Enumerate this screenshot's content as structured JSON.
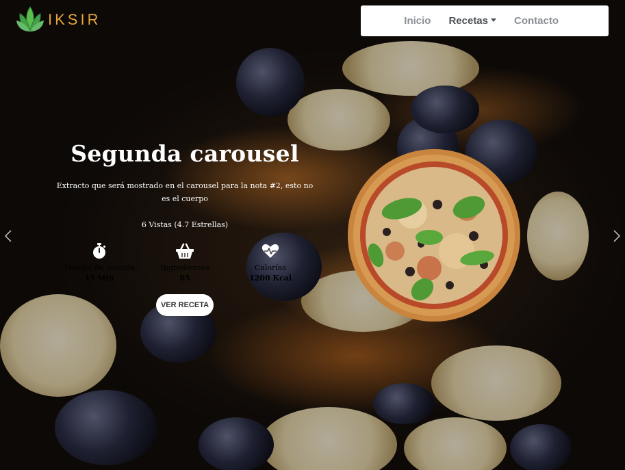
{
  "brand": {
    "name": "IKSIR",
    "accent": "#e2a43a",
    "logo_color": "#4caf50"
  },
  "nav": {
    "items": [
      {
        "label": "Inicio",
        "active": false
      },
      {
        "label": "Recetas",
        "active": true,
        "dropdown": true
      },
      {
        "label": "Contacto",
        "active": false
      }
    ]
  },
  "carousel": {
    "title": "Segunda carousel",
    "excerpt": "Extracto que será mostrado en el carousel para la nota #2, esto no es el cuerpo",
    "stats": "6 Vistas (4.7 Estrellas)",
    "meta": [
      {
        "icon": "stopwatch-icon",
        "label": "Tiempo de cocción",
        "value": "45 Min"
      },
      {
        "icon": "basket-icon",
        "label": "Ingredientes",
        "value": "85"
      },
      {
        "icon": "heartbeat-icon",
        "label": "Calorías",
        "value": "1200 Kcal"
      }
    ],
    "button_label": "VER RECETA",
    "prev_icon": "chevron-left-icon",
    "next_icon": "chevron-right-icon"
  }
}
